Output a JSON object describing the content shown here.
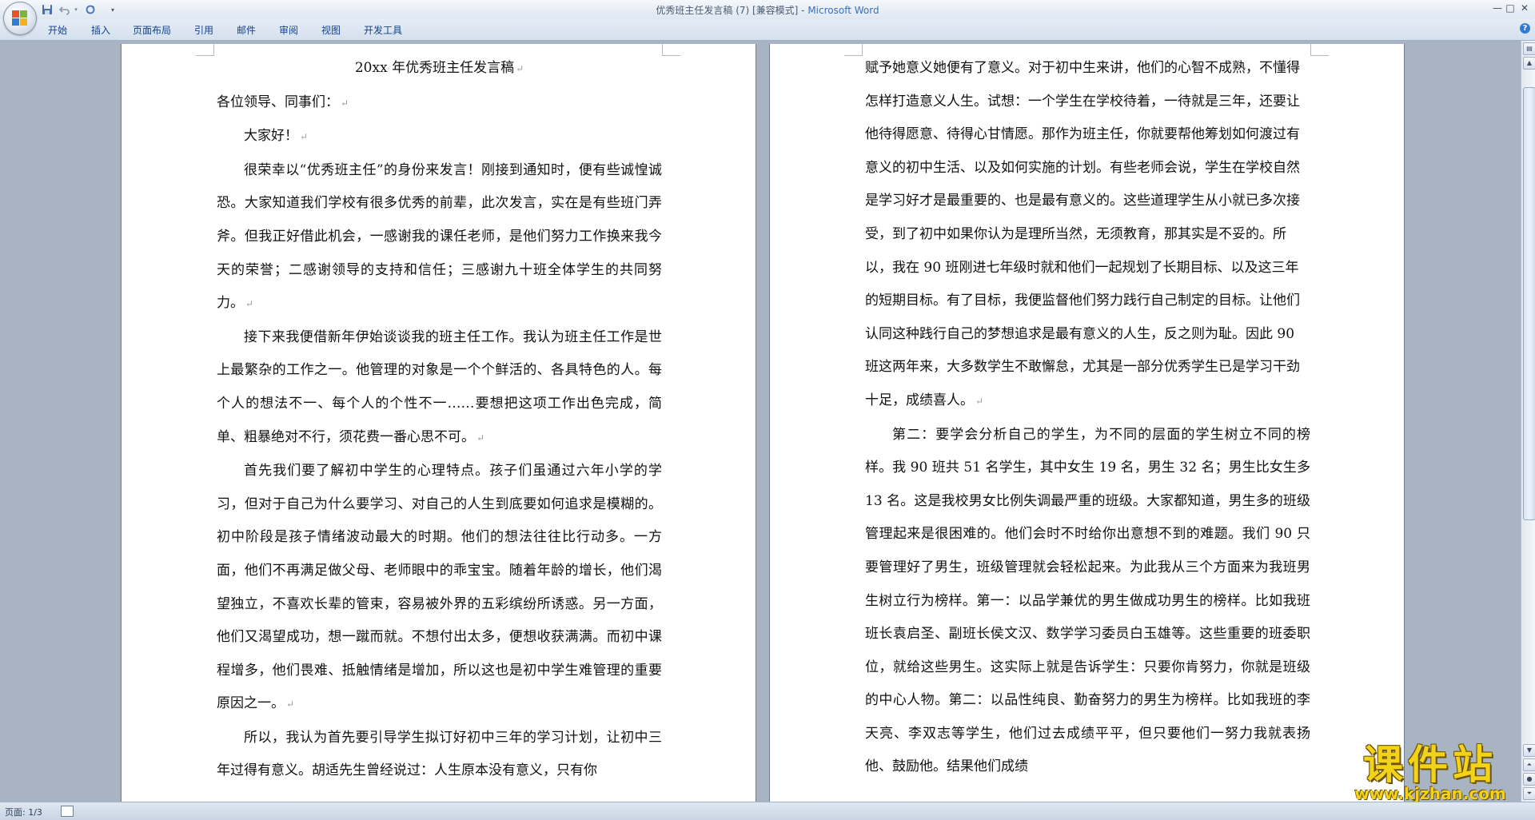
{
  "window": {
    "title_doc": "优秀班主任发言稿 (7) [兼容模式] - ",
    "title_app": "Microsoft Word",
    "controls": [
      "—",
      "□",
      "✕"
    ]
  },
  "quick_access": {
    "icons": [
      "save-icon",
      "undo-icon",
      "redo-icon",
      "customize-icon"
    ]
  },
  "ribbon": {
    "tabs": [
      {
        "label": "开始"
      },
      {
        "label": "插入"
      },
      {
        "label": "页面布局"
      },
      {
        "label": "引用"
      },
      {
        "label": "邮件"
      },
      {
        "label": "审阅"
      },
      {
        "label": "视图"
      },
      {
        "label": "开发工具"
      }
    ]
  },
  "page1": {
    "title": "20xx 年优秀班主任发言稿",
    "paragraphs": [
      {
        "text": "各位领导、同事们：",
        "indent": false
      },
      {
        "text": "大家好！",
        "indent": true
      },
      {
        "text": "很荣幸以“优秀班主任”的身份来发言！刚接到通知时，便有些诚惶诚恐。大家知道我们学校有很多优秀的前辈，此次发言，实在是有些班门弄斧。但我正好借此机会，一感谢我的课任老师，是他们努力工作换来我今天的荣誉；二感谢领导的支持和信任；三感谢九十班全体学生的共同努力。",
        "indent": true
      },
      {
        "text": "接下来我便借新年伊始谈谈我的班主任工作。我认为班主任工作是世上最繁杂的工作之一。他管理的对象是一个个鲜活的、各具特色的人。每个人的想法不一、每个人的个性不一……要想把这项工作出色完成，简单、粗暴绝对不行，须花费一番心思不可。",
        "indent": true
      },
      {
        "text": "首先我们要了解初中学生的心理特点。孩子们虽通过六年小学的学习，但对于自己为什么要学习、对自己的人生到底要如何追求是模糊的。初中阶段是孩子情绪波动最大的时期。他们的想法往往比行动多。一方面，他们不再满足做父母、老师眼中的乖宝宝。随着年龄的增长，他们渴望独立，不喜欢长辈的管束，容易被外界的五彩缤纷所诱惑。另一方面，他们又渴望成功，想一蹴而就。不想付出太多，便想收获满满。而初中课程增多，他们畏难、抵触情绪是增加，所以这也是初中学生难管理的重要原因之一。",
        "indent": true
      },
      {
        "text": "所以，我认为首先要引导学生拟订好初中三年的学习计划，让初中三年过得有意义。胡适先生曾经说过：人生原本没有意义，只有你",
        "indent": true,
        "nomark": true
      }
    ]
  },
  "page2": {
    "paragraphs": [
      {
        "text": "赋予她意义她便有了意义。对于初中生来讲，他们的心智不成熟，不懂得怎样打造意义人生。试想：一个学生在学校待着，一待就是三年，还要让他待得愿意、待得心甘情愿。那作为班主任，你就要帮他筹划如何渡过有意义的初中生活、以及如何实施的计划。有些老师会说，学生在学校自然是学习好才是最重要的、也是最有意义的。这些道理学生从小就已多次接受，到了初中如果你认为是理所当然，无须教育，那其实是不妥的。所以，我在 90 班刚进七年级时就和他们一起规划了长期目标、以及这三年的短期目标。有了目标，我便监督他们努力践行自己制定的目标。让他们认同这种践行自己的梦想追求是最有意义的人生，反之则为耻。因此 90 班这两年来，大多数学生不敢懈怠，尤其是一部分优秀学生已是学习干劲十足，成绩喜人。",
        "indent": false
      },
      {
        "text": "第二：要学会分析自己的学生，为不同的层面的学生树立不同的榜样。我 90 班共 51 名学生，其中女生 19 名，男生 32 名；男生比女生多 13 名。这是我校男女比例失调最严重的班级。大家都知道，男生多的班级管理起来是很困难的。他们会时不时给你出意想不到的难题。我们 90 只要管理好了男生，班级管理就会轻松起来。为此我从三个方面来为我班男生树立行为榜样。第一：以品学兼优的男生做成功男生的榜样。比如我班班长袁启圣、副班长侯文汉、数学学习委员白玉雄等。这些重要的班委职位，就给这些男生。这实际上就是告诉学生：只要你肯努力，你就是班级的中心人物。第二：以品性纯良、勤奋努力的男生为榜样。比如我班的李天亮、李双志等学生，他们过去成绩平平，但只要他们一努力我就表扬他、鼓励他。结果他们成绩",
        "indent": true,
        "nomark": true
      }
    ]
  },
  "para_mark": "↵",
  "status": {
    "page": "页面: 1/3"
  },
  "watermark": {
    "main": "课件站",
    "url": "www.kjzhan.com"
  }
}
